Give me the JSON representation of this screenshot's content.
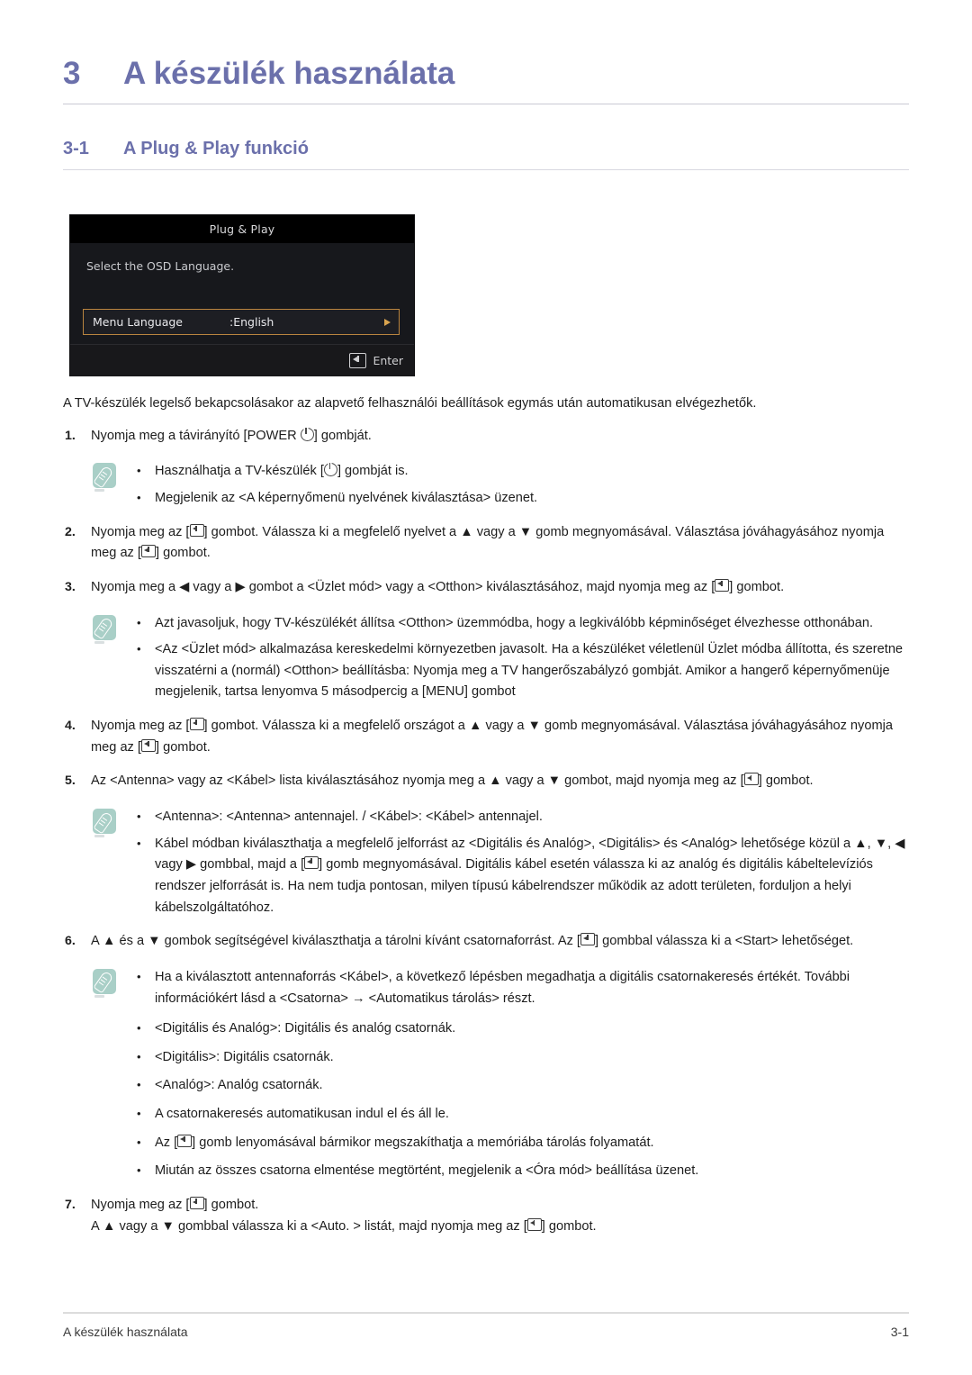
{
  "chapter": {
    "number": "3",
    "title": "A készülék használata"
  },
  "section": {
    "number": "3-1",
    "title": "A Plug & Play funkció"
  },
  "osd": {
    "title": "Plug & Play",
    "prompt": "Select the OSD Language.",
    "row_label": "Menu Language",
    "row_value": ":English",
    "footer_key": "Enter",
    "colors": {
      "highlight_border": "#b9843f",
      "panel_bg": "#17181c",
      "title_bg": "#000000"
    }
  },
  "intro": "A TV-készülék legelső bekapcsolásakor az alapvető felhasználói beállítások egymás után automatikusan elvégezhetők.",
  "steps": [
    {
      "num": "1.",
      "html": "Nyomja meg a távirányító [POWER <span class=\"key-power\" data-name=\"power-icon\" data-interactable=\"false\"></span>] gombját."
    },
    {
      "num": "2.",
      "html": "Nyomja meg az [<span class=\"key-enter\" data-name=\"enter-key-icon\" data-interactable=\"false\"></span>] gombot. Válassza ki a megfelelő nyelvet a ▲ vagy a ▼ gomb megnyomásával. Választása jóváhagyásához nyomja meg az [<span class=\"key-enter\" data-name=\"enter-key-icon\" data-interactable=\"false\"></span>] gombot."
    },
    {
      "num": "3.",
      "html": "Nyomja meg a ◀ vagy a ▶ gombot a &lt;Üzlet mód&gt; vagy a &lt;Otthon&gt; kiválasztásához, majd nyomja meg az [<span class=\"key-enter\" data-name=\"enter-key-icon\" data-interactable=\"false\"></span>] gombot."
    },
    {
      "num": "4.",
      "html": "Nyomja meg az [<span class=\"key-enter\" data-name=\"enter-key-icon\" data-interactable=\"false\"></span>] gombot. Válassza ki a megfelelő országot a ▲ vagy a ▼ gomb megnyomásával. Választása jóváhagyásához nyomja meg az [<span class=\"key-enter\" data-name=\"enter-key-icon\" data-interactable=\"false\"></span>] gombot."
    },
    {
      "num": "5.",
      "html": "Az &lt;Antenna&gt; vagy az &lt;Kábel&gt; lista kiválasztásához nyomja meg a ▲ vagy a ▼ gombot, majd nyomja meg az [<span class=\"key-enter\" data-name=\"enter-key-icon\" data-interactable=\"false\"></span>] gombot."
    },
    {
      "num": "6.",
      "html": "A ▲ és a ▼ gombok segítségével kiválaszthatja a tárolni kívánt csatornaforrást. Az [<span class=\"key-enter\" data-name=\"enter-key-icon\" data-interactable=\"false\"></span>] gombbal válassza ki a &lt;Start&gt; lehetőséget."
    },
    {
      "num": "7.",
      "html": "Nyomja meg az [<span class=\"key-enter\" data-name=\"enter-key-icon\" data-interactable=\"false\"></span>] gombot."
    }
  ],
  "step7_followup": "A ▲ vagy a ▼ gombbal válassza ki a &lt;Auto. &gt; listát, majd nyomja meg az [<span class=\"key-enter\" data-name=\"enter-key-icon\" data-interactable=\"false\"></span>] gombot.",
  "notes": {
    "note1": {
      "icon": "note-pencil-icon",
      "items": [
        "Használhatja a TV-készülék [<span class=\"key-power\" data-name=\"power-icon\" data-interactable=\"false\"></span>] gombját is.",
        "Megjelenik az &lt;A képernyőmenü nyelvének kiválasztása&gt; üzenet."
      ]
    },
    "note2": {
      "icon": "note-pencil-icon",
      "items": [
        "Azt javasoljuk, hogy TV-készülékét állítsa &lt;Otthon&gt; üzemmódba, hogy a legkiválóbb képminőséget élvezhesse otthonában.",
        "&lt;Az &lt;Üzlet mód&gt; alkalmazása kereskedelmi környezetben javasolt. Ha a készüléket véletlenül Üzlet módba állította, és szeretne visszatérni a (normál) &lt;Otthon&gt; beállításba: Nyomja meg a TV hangerőszabályzó gombját. Amikor a hangerő képernyőmenüje megjelenik, tartsa lenyomva 5 másodpercig a [MENU] gombot"
      ]
    },
    "note3": {
      "icon": "note-pencil-icon",
      "items": [
        "&lt;Antenna&gt;: &lt;Antenna&gt; antennajel. / &lt;Kábel&gt;: &lt;Kábel&gt; antennajel.",
        "Kábel módban kiválaszthatja a megfelelő jelforrást az &lt;Digitális és Analóg&gt;, &lt;Digitális&gt; és &lt;Analóg&gt; lehetősége közül a ▲, ▼, ◀ vagy ▶ gombbal, majd a [<span class=\"key-enter\" data-name=\"enter-key-icon\" data-interactable=\"false\"></span>] gomb megnyomásával. Digitális kábel esetén válassza ki az analóg és digitális kábeltelevíziós rendszer jelforrását is. Ha nem tudja pontosan, milyen típusú kábelrendszer működik az adott területen, forduljon a helyi kábelszolgáltatóhoz."
      ]
    },
    "note4": {
      "icon": "note-pencil-icon",
      "items": [
        "Ha a kiválasztott antennaforrás &lt;Kábel&gt;, a következő lépésben megadhatja a digitális csatornakeresés értékét. További információkért lásd a &lt;Csatorna&gt; → &lt;Automatikus tárolás&gt; részt."
      ]
    }
  },
  "plain_bullets": [
    "&lt;Digitális és Analóg&gt;: Digitális és analóg csatornák.",
    "&lt;Digitális&gt;: Digitális csatornák.",
    "&lt;Analóg&gt;: Analóg csatornák.",
    "A csatornakeresés automatikusan indul el és áll le.",
    "Az [<span class=\"key-enter\" data-name=\"enter-key-icon\" data-interactable=\"false\"></span>] gomb lenyomásával bármikor megszakíthatja a memóriába tárolás folyamatát.",
    "Miután az összes csatorna elmentése megtörtént, megjelenik a &lt;Óra mód&gt; beállítása üzenet."
  ],
  "bullet_char": "•",
  "footer": {
    "left": "A készülék használata",
    "right": "3-1"
  },
  "colors": {
    "heading": "#6b70ab",
    "note_chip": "#a9cfc7",
    "body_text": "#1d1d1d"
  }
}
